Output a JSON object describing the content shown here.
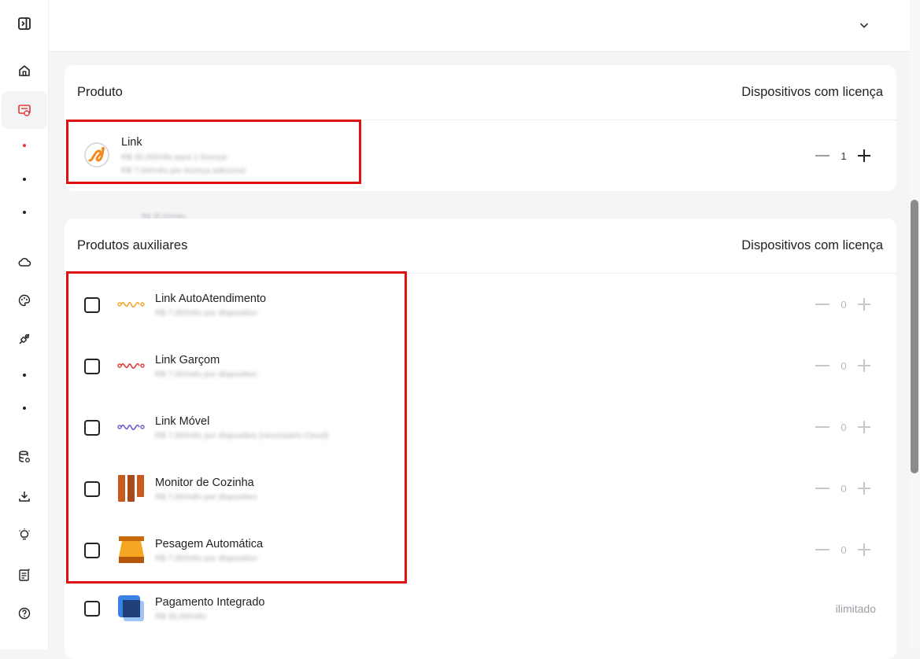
{
  "header": {
    "collapse_icon": "chevron-down-icon"
  },
  "sidebar": {
    "icons": [
      "sidebar-toggle-icon",
      "home-icon",
      "license-icon",
      "cloud-icon",
      "palette-icon",
      "plug-icon",
      "database-icon",
      "download-icon",
      "lightbulb-icon",
      "document-icon",
      "help-icon"
    ],
    "active_color": "#e53935"
  },
  "product_section": {
    "title": "Produto",
    "column": "Dispositivos com licença",
    "item": {
      "name": "Link",
      "price_line_1": "R$ 35,00/mês para 1 licença",
      "price_line_2": "R$ 7,00/mês por licença adicional",
      "qty": "1"
    }
  },
  "ghost_price": "R$ 35,00/mês",
  "aux_section": {
    "title": "Produtos auxiliares",
    "column": "Dispositivos com licença",
    "items": [
      {
        "name": "Link AutoAtendimento",
        "price": "R$ 7,00/mês por dispositivo",
        "qty": "0",
        "icon": "wave-icon-yellow"
      },
      {
        "name": "Link Garçom",
        "price": "R$ 7,00/mês por dispositivo",
        "qty": "0",
        "icon": "wave-icon-red"
      },
      {
        "name": "Link Móvel",
        "price": "R$ 7,00/mês por dispositivo (necessário Cloud)",
        "qty": "0",
        "icon": "wave-icon-purple"
      },
      {
        "name": "Monitor de Cozinha",
        "price": "R$ 7,00/mês por dispositivo",
        "qty": "0",
        "icon": "kitchen-monitor-icon"
      },
      {
        "name": "Pesagem Automática",
        "price": "R$ 7,00/mês por dispositivo",
        "qty": "0",
        "icon": "scale-icon"
      },
      {
        "name": "Pagamento Integrado",
        "price": "R$ 35,00/mês",
        "limit": "ilimitado",
        "icon": "payment-icon"
      }
    ]
  },
  "colors": {
    "highlight": "#e01010",
    "wave_yellow": "#f5a623",
    "wave_red": "#e53935",
    "wave_purple": "#6a5acd",
    "kitchen": "#c85a1e",
    "scale": "#f39c12",
    "payment": "#1e5aa8"
  }
}
